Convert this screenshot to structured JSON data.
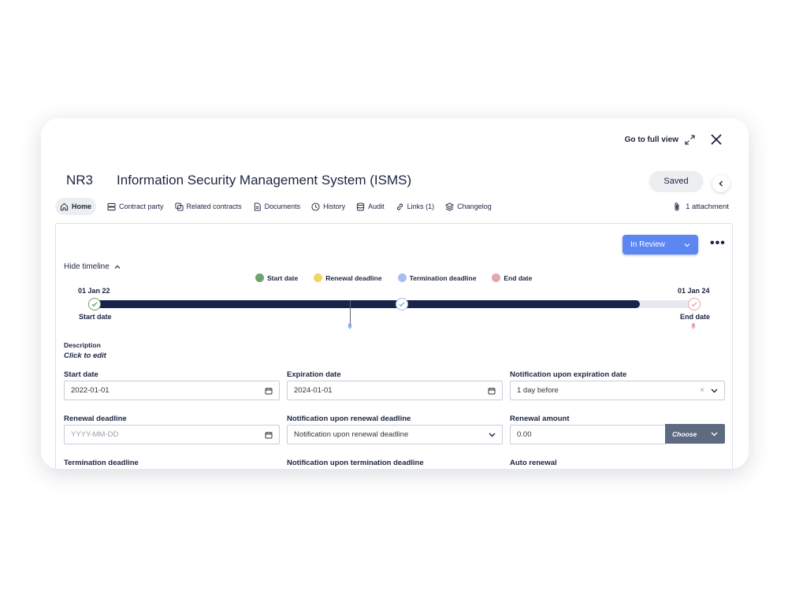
{
  "header": {
    "full_view_label": "Go to full view",
    "code": "NR3",
    "title": "Information Security Management System (ISMS)",
    "saved_label": "Saved"
  },
  "tabs": [
    {
      "label": "Home",
      "icon": "home-icon",
      "active": true
    },
    {
      "label": "Contract party",
      "icon": "party-icon"
    },
    {
      "label": "Related contracts",
      "icon": "copy-icon"
    },
    {
      "label": "Documents",
      "icon": "document-icon"
    },
    {
      "label": "History",
      "icon": "clock-icon"
    },
    {
      "label": "Audit",
      "icon": "database-icon"
    },
    {
      "label": "Links (1)",
      "icon": "link-icon"
    },
    {
      "label": "Changelog",
      "icon": "layers-icon"
    }
  ],
  "attachment_label": "1 attachment",
  "status": {
    "label": "In Review",
    "color": "#5c86f2"
  },
  "timeline": {
    "toggle_label": "Hide timeline",
    "legend": [
      {
        "label": "Start date",
        "color": "#6ea26e"
      },
      {
        "label": "Renewal deadline",
        "color": "#f1d55e"
      },
      {
        "label": "Termination deadline",
        "color": "#a7bff2"
      },
      {
        "label": "End date",
        "color": "#e3a6ae"
      }
    ],
    "start_date": "01 Jan 22",
    "start_label": "Start date",
    "end_date": "01 Jan 24",
    "end_label": "End date",
    "progress": 0.91
  },
  "description": {
    "label": "Description",
    "placeholder": "Click to edit"
  },
  "fields": {
    "start_date": {
      "label": "Start date",
      "value": "2022-01-01"
    },
    "expiration_date": {
      "label": "Expiration date",
      "value": "2024-01-01"
    },
    "notif_expiration": {
      "label": "Notification upon expiration date",
      "value": "1 day before"
    },
    "renewal_deadline": {
      "label": "Renewal deadline",
      "placeholder": "YYYY-MM-DD"
    },
    "notif_renewal": {
      "label": "Notification upon renewal deadline",
      "value": "Notification upon renewal deadline"
    },
    "renewal_amount": {
      "label": "Renewal amount",
      "value": "0.00",
      "choose_label": "Choose"
    },
    "termination_deadline": {
      "label": "Termination deadline"
    },
    "notif_termination": {
      "label": "Notification upon termination deadline"
    },
    "auto_renewal": {
      "label": "Auto renewal"
    }
  }
}
